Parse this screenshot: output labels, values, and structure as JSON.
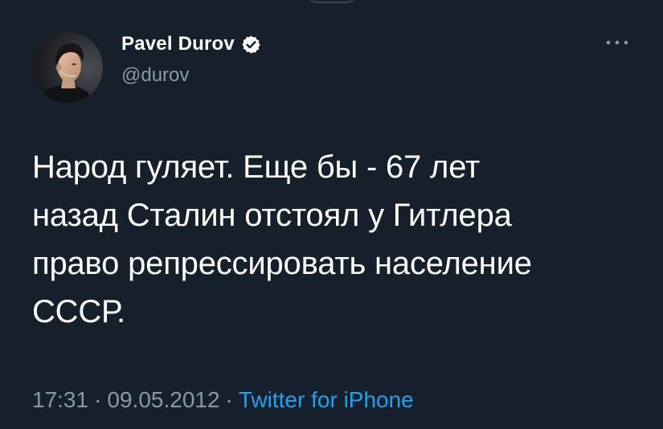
{
  "author": {
    "display_name": "Pavel Durov",
    "handle": "@durov",
    "verified": true
  },
  "tweet": {
    "text_lines": [
      "Народ гуляет. Еще бы - 67 лет",
      "назад Сталин отстоял у Гитлера",
      "право репрессировать население",
      "СССР."
    ],
    "time": "17:31",
    "date": "09.05.2012",
    "separator": "·",
    "source": "Twitter for iPhone"
  },
  "icons": {
    "verified": "verified-badge-icon",
    "more": "more-options-icon"
  },
  "colors": {
    "background": "#15202b",
    "primary_text": "#ffffff",
    "secondary_text": "#8899a6",
    "accent": "#1da1f2"
  }
}
